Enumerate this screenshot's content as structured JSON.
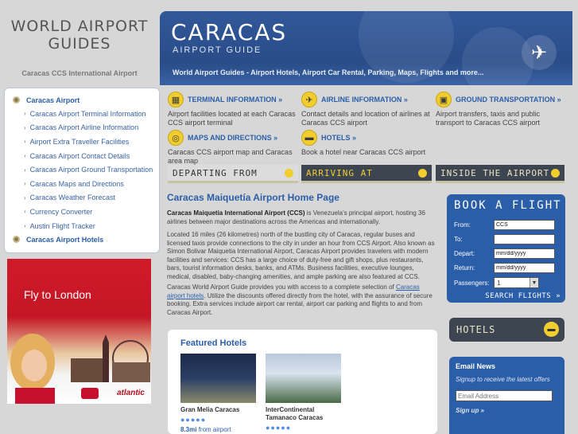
{
  "logo": {
    "line1": "WORLD AIRPORT",
    "line2": "GUIDES"
  },
  "site_subtitle": "Caracas CCS International Airport",
  "header": {
    "city": "CARACAS",
    "guide": "AIRPORT GUIDE",
    "tagline": "World Airport Guides - Airport Hotels, Airport Car Rental, Parking, Maps, Flights and more..."
  },
  "sidebar": {
    "main_top": "Caracas Airport",
    "items": [
      "Caracas Airport Terminal Information",
      "Caracas Airport Airline Information",
      "Airport Extra Traveller Facilities",
      "Caracas Airport Contact Details",
      "Caracas Airport Ground Transportation",
      "Caracas Maps and Directions",
      "Caracas Weather Forecast",
      "Currency Converter",
      "Austin Flight Tracker"
    ],
    "main_bottom": "Caracas Airport Hotels"
  },
  "ad": {
    "headline": "Fly to London",
    "brand": "atlantic"
  },
  "info": {
    "terminal": {
      "title": "TERMINAL INFORMATION »",
      "desc": "Airport facilities located at each Caracas CCS airport terminal"
    },
    "airline": {
      "title": "AIRLINE INFORMATION »",
      "desc": "Contact details and location of airlines at Caracas CCS airport"
    },
    "ground": {
      "title": "GROUND TRANSPORTATION »",
      "desc": "Airport transfers, taxis and public transport to Caracas CCS airport"
    },
    "maps": {
      "title": "MAPS AND DIRECTIONS »",
      "desc": "Caracas CCS airport map and Caracas area map"
    },
    "hotels": {
      "title": "HOTELS »",
      "desc": "Book a hotel near Caracas CCS airport"
    }
  },
  "strips": {
    "departing": "DEPARTING FROM",
    "arriving": "ARRIVING AT",
    "inside": "INSIDE THE AIRPORT"
  },
  "main": {
    "title": "Caracas Maiquetía Airport Home Page",
    "p1_bold": "Caracas Maiquetia International Airport (CCS)",
    "p1_rest": " is Venezuela's principal airport, hosting 36 airlines between major destinations across the Americas and internationally.",
    "p2": "Located 16 miles (26 kilometres) north of the bustling city of Caracas, regular buses and licensed taxis provide connections to the city in under an hour from CCS Airport. Also known as Simon Bolivar Maiquetia International Airport, Caracas Airport provides travelers with modern facilities and services: CCS has a large choice of duty-free and gift shops, plus restaurants, bars, tourist information desks, banks, and ATMs. Business facilities, executive lounges, medical, disabled, baby-changing amenities, and ample parking are also featured at CCS.",
    "p3_a": "Caracas World Airport Guide provides you with access to a complete selection of ",
    "p3_link": "Caracas airport hotels",
    "p3_b": ". Utilize the discounts offered directly from the hotel, with the assurance of secure booking. Extra services include airport car rental, airport car parking and flights to and from Caracas Airport."
  },
  "featured": {
    "title": "Featured Hotels",
    "hotels": [
      {
        "name": "Gran Melia Caracas",
        "stars": "●●●●●",
        "dist_value": "8.3mi",
        "dist_text": " from airport"
      },
      {
        "name": "InterContinental Tamanaco Caracas",
        "stars": "●●●●●"
      }
    ]
  },
  "book": {
    "title": "BOOK A FLIGHT",
    "from_label": "From:",
    "from_value": "CCS",
    "to_label": "To:",
    "depart_label": "Depart:",
    "depart_value": "mm/dd/yyyy",
    "return_label": "Return:",
    "return_value": "mm/dd/yyyy",
    "passengers_label": "Passengers:",
    "passengers_value": "1",
    "search": "SEARCH FLIGHTS »"
  },
  "hotels_box": {
    "title": "HOTELS"
  },
  "news": {
    "title": "Email News",
    "text": "Signup to receive the latest offers",
    "placeholder": "Email Address",
    "signup": "Sign up »"
  }
}
